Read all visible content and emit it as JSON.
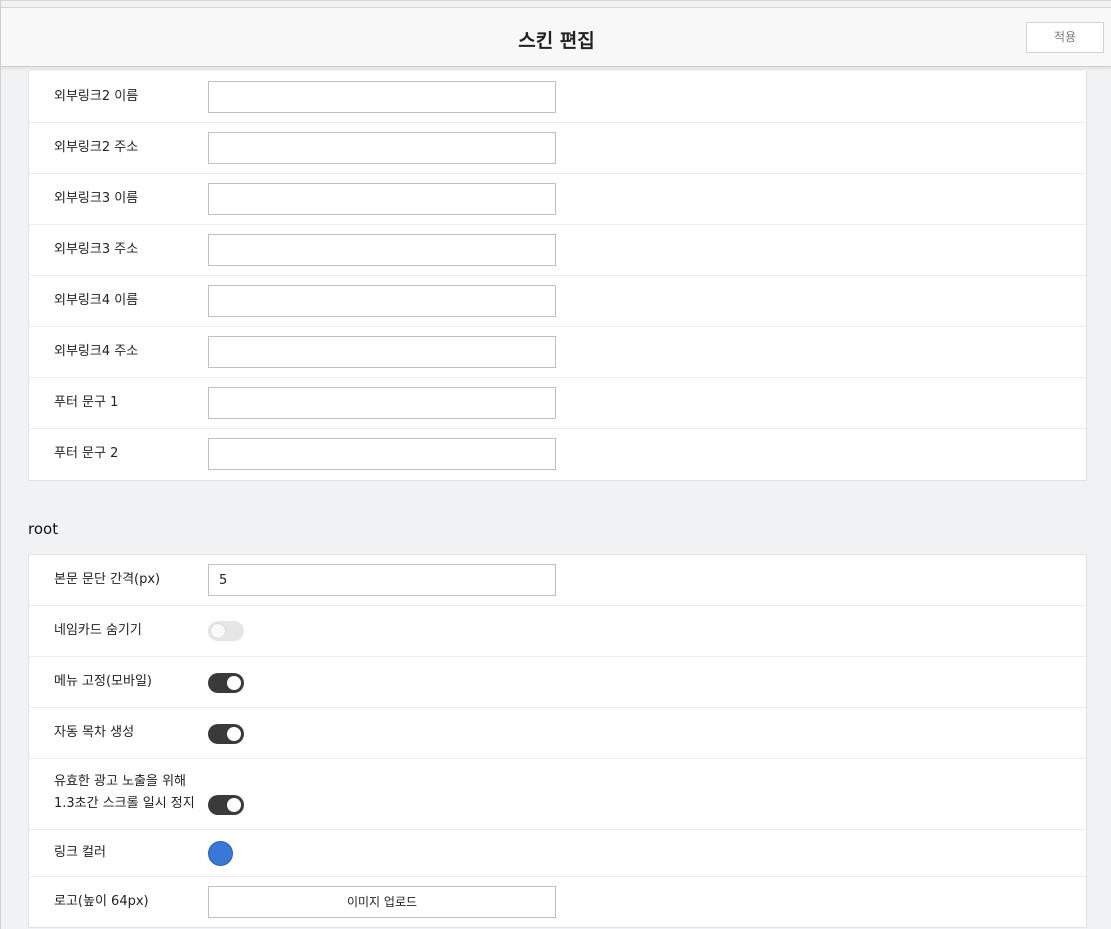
{
  "header": {
    "title": "스킨 편집",
    "apply_label": "적용"
  },
  "links_section": {
    "rows": [
      {
        "label": "외부링크2 이름",
        "value": ""
      },
      {
        "label": "외부링크2 주소",
        "value": ""
      },
      {
        "label": "외부링크3 이름",
        "value": ""
      },
      {
        "label": "외부링크3 주소",
        "value": ""
      },
      {
        "label": "외부링크4 이름",
        "value": ""
      },
      {
        "label": "외부링크4 주소",
        "value": ""
      },
      {
        "label": "푸터 문구 1",
        "value": ""
      },
      {
        "label": "푸터 문구 2",
        "value": ""
      }
    ]
  },
  "root_section": {
    "title": "root",
    "paragraph_spacing": {
      "label": "본문 문단 간격(px)",
      "value": "5"
    },
    "hide_namecard": {
      "label": "네임카드 숨기기",
      "on": false
    },
    "fixed_menu_mobile": {
      "label": "메뉴 고정(모바일)",
      "on": true
    },
    "auto_toc": {
      "label": "자동 목차 생성",
      "on": true
    },
    "scroll_pause": {
      "label_line1": "유효한 광고 노출을 위해",
      "label_line2": "1.3초간 스크롤 일시 정지",
      "on": true
    },
    "link_color": {
      "label": "링크 컬러",
      "color": "#3a78d8"
    },
    "logo": {
      "label": "로고(높이 64px)",
      "button_label": "이미지 업로드"
    }
  }
}
